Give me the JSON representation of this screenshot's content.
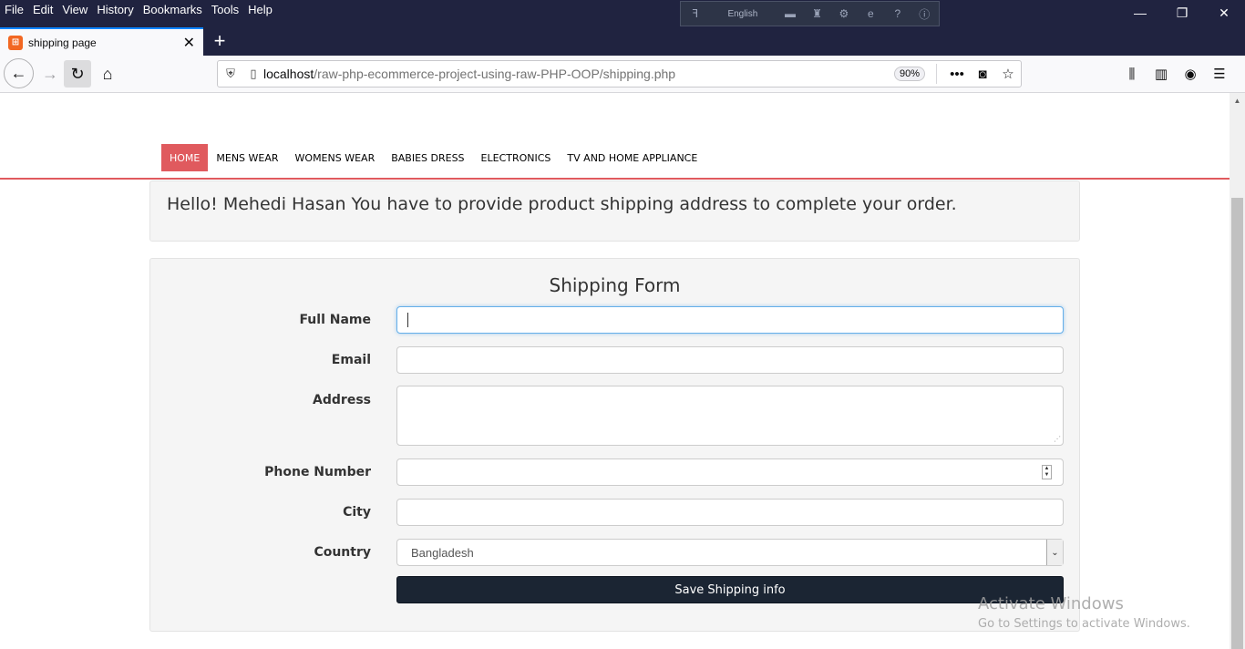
{
  "menu": [
    "File",
    "Edit",
    "View",
    "History",
    "Bookmarks",
    "Tools",
    "Help"
  ],
  "extension": {
    "language": "English"
  },
  "tab": {
    "title": "shipping page",
    "close": "✕"
  },
  "url": {
    "host": "localhost",
    "path": "/raw-php-ecommerce-project-using-raw-PHP-OOP/shipping.php",
    "zoom": "90%"
  },
  "site_nav": [
    "HOME",
    "MENS WEAR",
    "WOMENS WEAR",
    "BABIES DRESS",
    "ELECTRONICS",
    "TV AND HOME APPLIANCE"
  ],
  "alert": "Hello! Mehedi Hasan You have to provide product shipping address to complete your order.",
  "form": {
    "title": "Shipping Form",
    "labels": {
      "full_name": "Full Name",
      "email": "Email",
      "address": "Address",
      "phone": "Phone Number",
      "city": "City",
      "country": "Country"
    },
    "values": {
      "full_name": "",
      "email": "",
      "address": "",
      "phone": "",
      "city": ""
    },
    "country_selected": "Bangladesh",
    "submit": "Save Shipping info"
  },
  "watermark": {
    "title": "Activate Windows",
    "subtitle": "Go to Settings to activate Windows."
  },
  "colors": {
    "titlebar": "#202340",
    "accent_red": "#e05a5e",
    "button_dark": "#1b2533"
  }
}
